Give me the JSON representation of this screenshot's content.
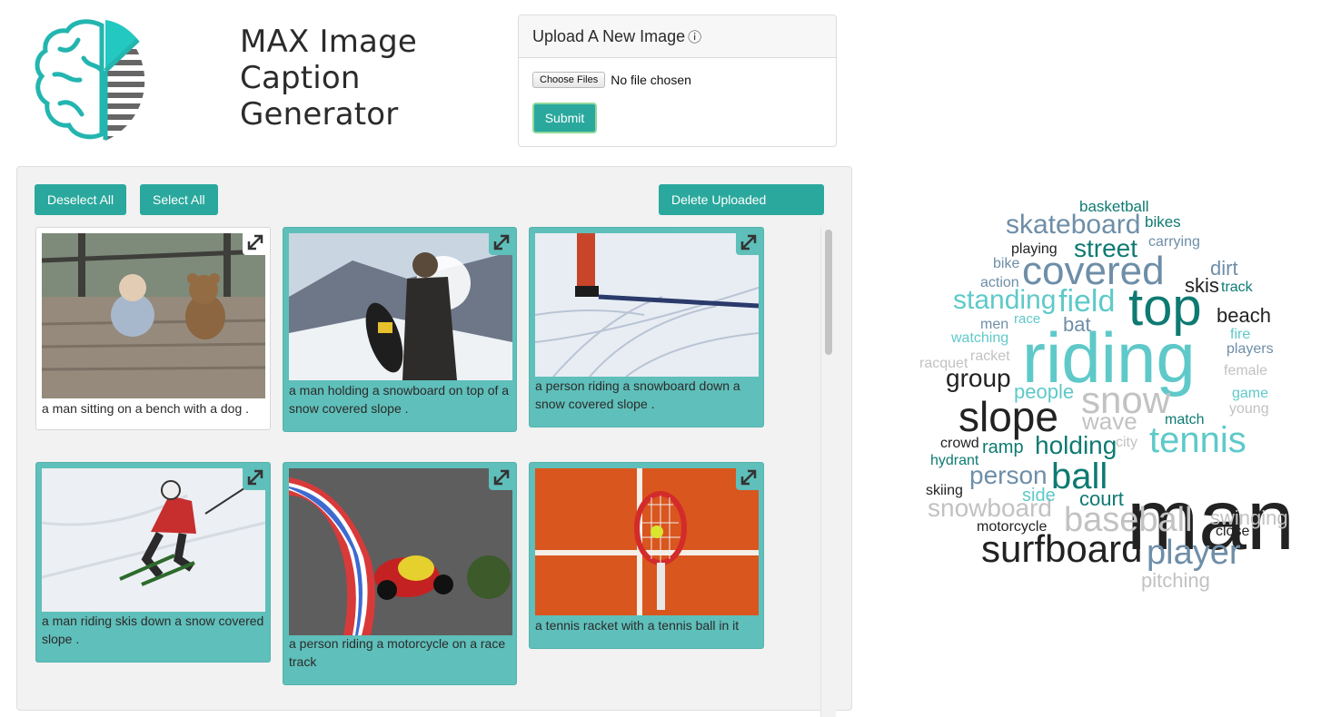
{
  "header": {
    "title": "MAX Image Caption Generator"
  },
  "upload": {
    "header": "Upload A New Image",
    "info_icon": "info-circle-icon",
    "choose_label": "Choose Files",
    "file_status": "No file chosen",
    "submit_label": "Submit"
  },
  "toolbar": {
    "deselect_label": "Deselect All",
    "select_label": "Select All",
    "delete_label": "Delete Uploaded Images"
  },
  "cards": [
    {
      "caption": "a man sitting on a bench with a dog .",
      "selected": false
    },
    {
      "caption": "a man holding a snowboard on top of a snow covered slope .",
      "selected": true
    },
    {
      "caption": "a person riding a snowboard down a snow covered slope .",
      "selected": true
    },
    {
      "caption": "a man riding skis down a snow covered slope .",
      "selected": true
    },
    {
      "caption": "a person riding a motorcycle on a race track",
      "selected": true
    },
    {
      "caption": "a tennis racket with a tennis ball in it",
      "selected": true
    }
  ],
  "colors": {
    "accent": "#2aa89d",
    "card_selected": "#5fbfba",
    "panel_bg": "#f2f2f2"
  },
  "wordcloud": {
    "words": [
      "man",
      "riding",
      "top",
      "slope",
      "surfboard",
      "covered",
      "snow",
      "tennis",
      "player",
      "baseball",
      "ball",
      "skateboard",
      "street",
      "field",
      "standing",
      "holding",
      "wave",
      "person",
      "snowboard",
      "beach",
      "group",
      "dirt",
      "skis",
      "court",
      "people",
      "side",
      "ramp",
      "bat",
      "basketball",
      "bikes",
      "playing",
      "carrying",
      "bike",
      "action",
      "track",
      "men",
      "race",
      "fire",
      "watching",
      "players",
      "racket",
      "racquet",
      "female",
      "game",
      "young",
      "match",
      "crowd",
      "city",
      "hydrant",
      "skiing",
      "motorcycle",
      "swinging",
      "close",
      "pitching"
    ]
  }
}
